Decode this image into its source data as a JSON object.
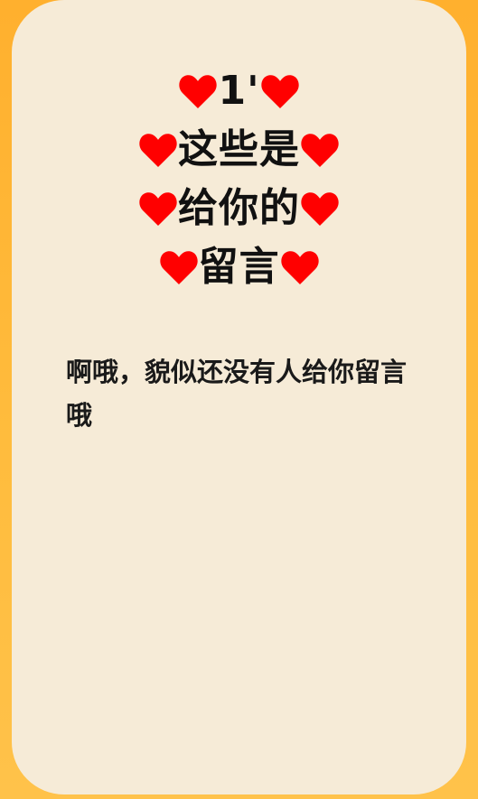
{
  "title": {
    "lines": [
      "1'",
      "这些是",
      "给你的",
      "留言"
    ],
    "heart_icon": "heart-icon",
    "heart_color": "#FF0000"
  },
  "message": {
    "line1": "啊哦，貌似还没有人给你留言",
    "line2": "哦"
  },
  "colors": {
    "background": "#FFB733",
    "card": "#F6EBD7",
    "text": "#111111"
  }
}
